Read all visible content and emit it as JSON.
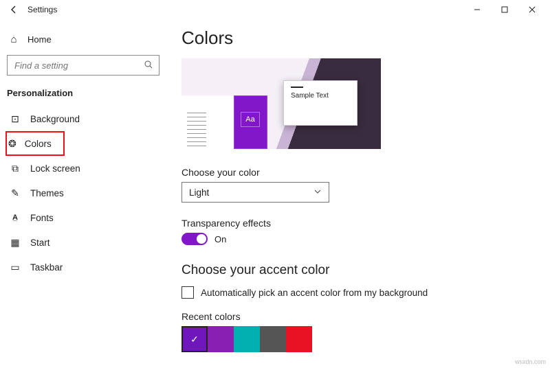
{
  "window": {
    "title": "Settings"
  },
  "sidebar": {
    "home": "Home",
    "search_placeholder": "Find a setting",
    "group": "Personalization",
    "items": [
      {
        "icon": "🖼",
        "label": "Background"
      },
      {
        "icon": "🎨",
        "label": "Colors"
      },
      {
        "icon": "🔒",
        "label": "Lock screen"
      },
      {
        "icon": "🖌",
        "label": "Themes"
      },
      {
        "icon": "A",
        "label": "Fonts"
      },
      {
        "icon": "▦",
        "label": "Start"
      },
      {
        "icon": "▭",
        "label": "Taskbar"
      }
    ]
  },
  "page": {
    "title": "Colors",
    "preview_sample": "Sample Text",
    "preview_aa": "Aa",
    "choose_color_label": "Choose your color",
    "choose_color_value": "Light",
    "transparency_label": "Transparency effects",
    "transparency_value": "On",
    "accent_heading": "Choose your accent color",
    "auto_pick_label": "Automatically pick an accent color from my background",
    "recent_label": "Recent colors",
    "recent_colors": [
      "#6f17bd",
      "#8a1fb4",
      "#00b0b0",
      "#555555",
      "#e81224"
    ]
  },
  "watermark": "wsxdn.com"
}
